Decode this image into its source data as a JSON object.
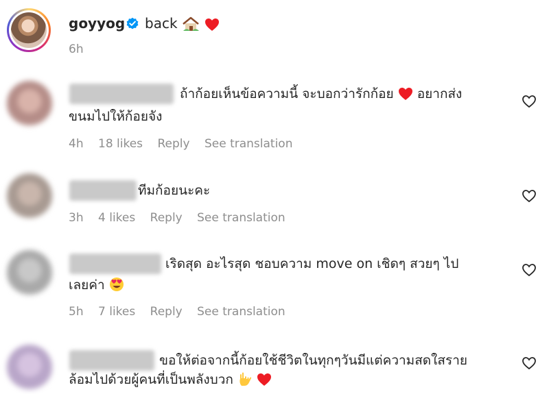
{
  "post": {
    "username": "goyyog",
    "caption": "back",
    "time": "6h"
  },
  "comments": [
    {
      "line1": "ถ้าก้อยเห็นข้อความนี้ จะบอกว่ารักก้อย",
      "line1_tail": "อยากส่ง",
      "line2": "ขนมไปให้ก้อยจัง",
      "time": "4h",
      "likes": "18 likes",
      "reply": "Reply",
      "translate": "See translation"
    },
    {
      "line1": "ทีมก้อยนะคะ",
      "time": "3h",
      "likes": "4 likes",
      "reply": "Reply",
      "translate": "See translation"
    },
    {
      "line1": "เริดสุด อะไรสุด ชอบความ move on เชิดๆ สวยๆ ไป",
      "line2": "เลยค่า",
      "time": "5h",
      "likes": "7 likes",
      "reply": "Reply",
      "translate": "See translation"
    },
    {
      "line1": "ขอให้ต่อจากนี้ก้อยใช้ชีวิตในทุกๆวันมีแต่ความสดใสราย",
      "line2": "ล้อมไปด้วยผู้คนที่เป็นพลังบวก"
    }
  ],
  "icons": {
    "verified": "verified-badge-icon",
    "house": "house-emoji-icon",
    "heart": "red-heart-emoji-icon",
    "like": "heart-outline-icon",
    "heart_eyes": "heart-eyes-emoji-icon",
    "rock_hand": "love-you-gesture-emoji-icon"
  },
  "colors": {
    "text": "#262626",
    "secondary": "#8e8e8e",
    "verified": "#0095f6",
    "heart": "#ed1c24"
  }
}
